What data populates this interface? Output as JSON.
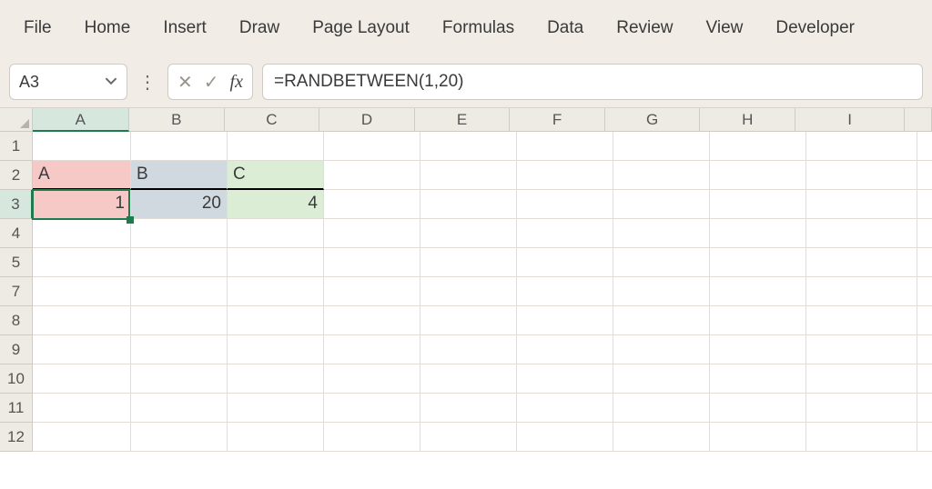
{
  "ribbon": {
    "tabs": [
      "File",
      "Home",
      "Insert",
      "Draw",
      "Page Layout",
      "Formulas",
      "Data",
      "Review",
      "View",
      "Developer"
    ]
  },
  "nameBox": {
    "value": "A3"
  },
  "fx": {
    "cancel": "✕",
    "confirm": "✓",
    "label": "fx"
  },
  "formula": "=RANDBETWEEN(1,20)",
  "columns": [
    "A",
    "B",
    "C",
    "D",
    "E",
    "F",
    "G",
    "H",
    "I",
    ""
  ],
  "selectedCol": "A",
  "rows": [
    "1",
    "2",
    "3",
    "4",
    "5",
    "7",
    "8",
    "9",
    "10",
    "11",
    "12"
  ],
  "selectedRow": "3",
  "cells": {
    "r2": {
      "A": "A",
      "B": "B",
      "C": "C"
    },
    "r3": {
      "A": "1",
      "B": "20",
      "C": "4"
    }
  },
  "colors": {
    "accent": "#1f7a4d",
    "fillA": "#f6c9c7",
    "fillB": "#cfd9df",
    "fillC": "#dbeed5"
  }
}
